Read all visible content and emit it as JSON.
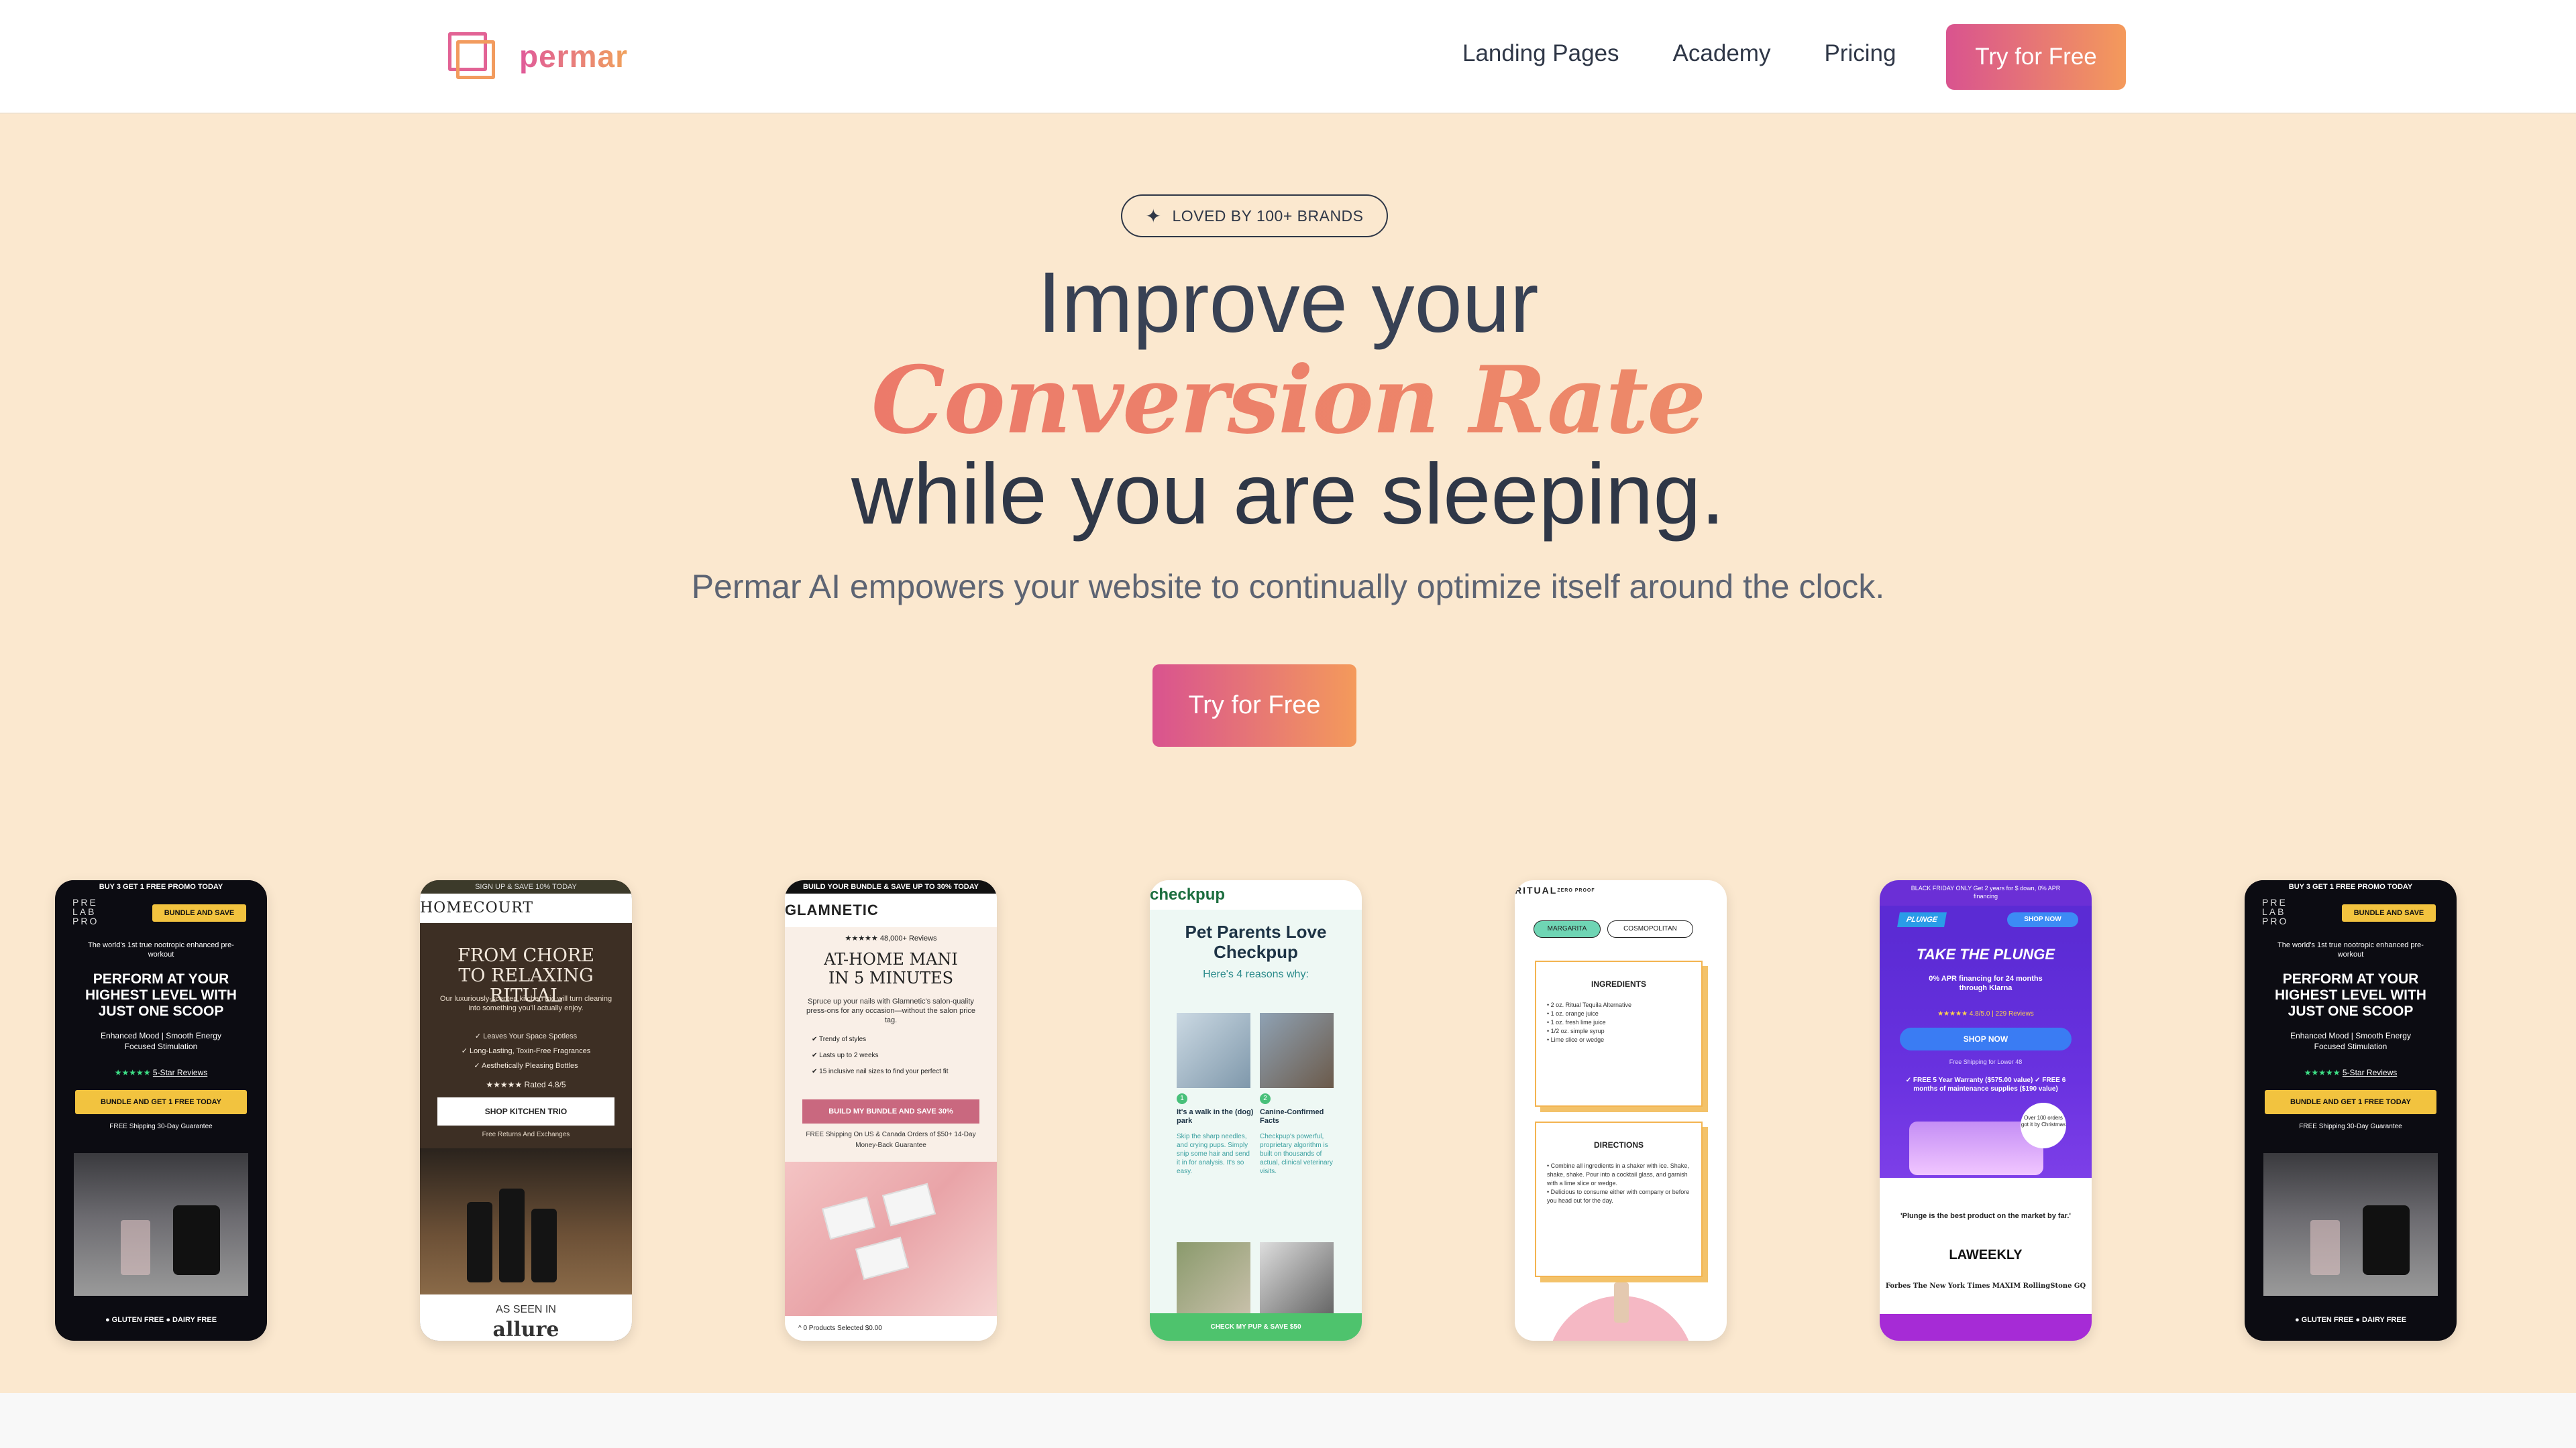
{
  "nav": {
    "logo_text": "permar",
    "links": [
      "Landing Pages",
      "Academy",
      "Pricing"
    ],
    "cta": "Try for Free"
  },
  "hero": {
    "badge": "LOVED BY 100+ BRANDS",
    "line1": "Improve your",
    "line2": "Conversion Rate",
    "line3": "while you are sleeping.",
    "subtitle": "Permar AI empowers your website to continually optimize itself around the clock.",
    "cta": "Try for Free"
  },
  "colors": {
    "accent_start": "#d9538f",
    "accent_end": "#f49a5b",
    "hero_bg": "#fbe8cf",
    "heading": "#384154"
  },
  "phones": {
    "prelab": {
      "topbar": "BUY 3 GET 1 FREE PROMO TODAY",
      "brand": "PRE LAB PRO",
      "bundle_pill": "BUNDLE AND SAVE",
      "tagline": "The world's 1st true nootropic enhanced pre-workout",
      "headline": "PERFORM AT YOUR HIGHEST LEVEL WITH JUST ONE SCOOP",
      "benefits": "Enhanced Mood | Smooth Energy Focused Stimulation",
      "stars": "★★★★★",
      "reviews": "5-Star Reviews",
      "button": "BUNDLE AND GET 1 FREE TODAY",
      "shipping": "FREE Shipping     30-Day Guarantee",
      "bottom": "● GLUTEN FREE      ● DAIRY FREE"
    },
    "homecourt": {
      "topbar": "SIGN UP & SAVE 10% TODAY",
      "logo": "HOMECOURT",
      "headline": "FROM CHORE TO RELAXING RITUAL",
      "description": "Our luxuriously-scented kitchen trio will turn cleaning into something you'll actually enjoy.",
      "list": [
        "✓  Leaves Your Space Spotless",
        "✓  Long-Lasting, Toxin-Free Fragrances",
        "✓  Aesthetically Pleasing Bottles"
      ],
      "stars": "★★★★★  Rated 4.8/5",
      "button": "SHOP KITCHEN TRIO",
      "free": "Free Returns And Exchanges",
      "seen_in": "AS SEEN IN",
      "seen_logo": "allure"
    },
    "glamnetic": {
      "topbar": "BUILD YOUR BUNDLE & SAVE UP TO 30% TODAY",
      "logo": "GLAMNETIC",
      "stars": "★★★★★  48,000+ Reviews",
      "headline": "AT-HOME MANI IN 5 MINUTES",
      "description": "Spruce up your nails with Glamnetic's salon-quality press-ons for any occasion—without the salon price tag.",
      "list": [
        "✔  Trendy of styles",
        "✔  Lasts up to 2 weeks",
        "✔  15 inclusive nail sizes to find your perfect fit"
      ],
      "button": "BUILD MY BUNDLE AND SAVE 30%",
      "shipping": "FREE Shipping On US & Canada Orders of $50+ 14-Day Money-Back Guarantee",
      "footer": "^  0 Products Selected                                  $0.00"
    },
    "checkpup": {
      "logo": "checkpup",
      "headline": "Pet Parents Love Checkpup",
      "sub": "Here's 4 reasons why:",
      "col1_head": "It's a walk in the (dog) park",
      "col1_body": "Skip the sharp needles, and crying pups. Simply snip some hair and send it in for analysis. It's so easy.",
      "col2_head": "Canine-Confirmed Facts",
      "col2_body": "Checkpup's powerful, proprietary algorithm is built on thousands of actual, clinical veterinary visits.",
      "footer": "CHECK MY PUP & SAVE $50"
    },
    "ritual": {
      "logo": "RITUAL",
      "logo_sub": "ZERO PROOF",
      "tabs": [
        "MARGARITA",
        "COSMOPOLITAN"
      ],
      "ingredients_title": "INGREDIENTS",
      "ingredients": [
        "• 2 oz. Ritual Tequila Alternative",
        "• 1 oz. orange juice",
        "• 1 oz. fresh lime juice",
        "• 1/2 oz. simple syrup",
        "• Lime slice or wedge"
      ],
      "directions_title": "DIRECTIONS",
      "directions": [
        "• Combine all ingredients in a shaker with ice. Shake, shake, shake. Pour into a cocktail glass, and garnish with a lime slice or wedge.",
        "• Delicious to consume either with company or before you head out for the day."
      ]
    },
    "plunge": {
      "topbar": "BLACK FRIDAY ONLY Get 2 years for $ down, 0% APR financing",
      "logo": "PLUNGE",
      "shop_small": "SHOP NOW",
      "headline": "TAKE THE PLUNGE",
      "financing": "0% APR financing for 24 months through Klarna",
      "stars": "★★★★★  4.8/5.0 | 229 Reviews",
      "shop_big": "SHOP NOW",
      "free_shipping": "Free Shipping for Lower 48",
      "perks": "✓ FREE 5 Year Warranty ($575.00 value) ✓ FREE 6 months of maintenance supplies ($190 value)",
      "seal": "Over 100 orders got it by Christmas",
      "quote": "'Plunge is the best product on the market by far.'",
      "press": "LAWEEKLY",
      "logos": "Forbes  The New York Times  MAXIM  RollingStone  GQ"
    }
  }
}
